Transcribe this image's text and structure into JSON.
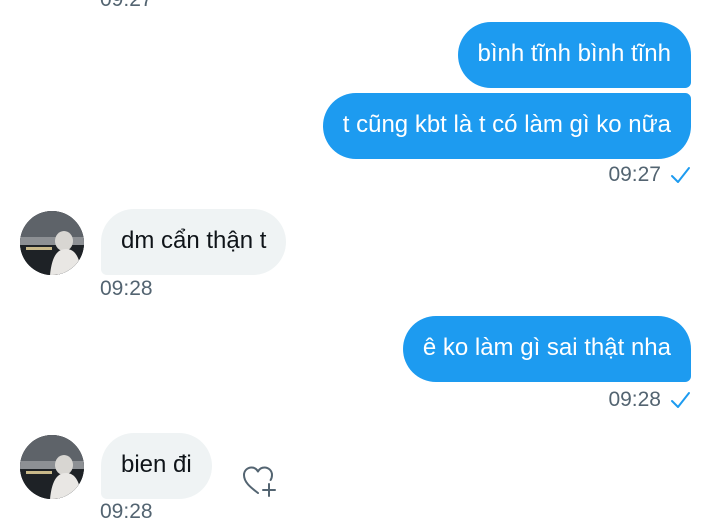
{
  "conversation": {
    "cutoff_time": "09:27",
    "messages": [
      {
        "id": "out1",
        "direction": "outgoing",
        "text": "bình tĩnh bình tĩnh"
      },
      {
        "id": "out2",
        "direction": "outgoing",
        "text": "t cũng kbt là t có làm gì ko nữa",
        "time": "09:27",
        "status": "seen-check-icon"
      },
      {
        "id": "in1",
        "direction": "incoming",
        "text": "dm cẩn thận t",
        "time": "09:28"
      },
      {
        "id": "out3",
        "direction": "outgoing",
        "text": "ê ko làm gì sai thật nha",
        "time": "09:28",
        "status": "seen-check-icon"
      },
      {
        "id": "in2",
        "direction": "incoming",
        "text": "bien đi",
        "time": "09:28",
        "reaction_icon": "heart-plus-icon"
      }
    ]
  },
  "colors": {
    "outgoing_bubble": "#1d9bf0",
    "incoming_bubble": "#eff3f4",
    "timestamp": "#536471",
    "check": "#1d9bf0"
  }
}
